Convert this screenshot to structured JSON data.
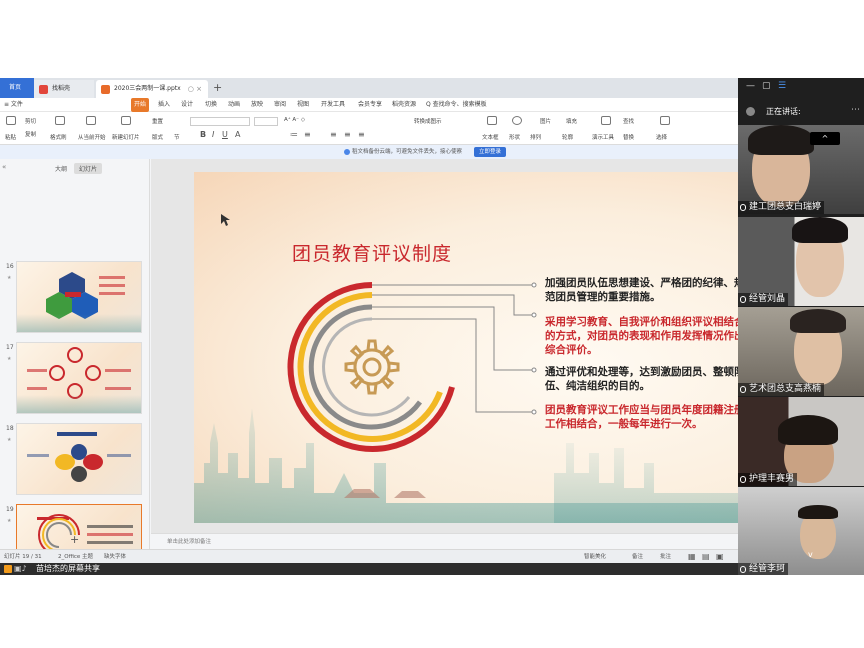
{
  "wps": {
    "tabs": {
      "home": "首页",
      "template": "找稻壳",
      "document": "2020三会两制一课.pptx",
      "close": "○ ×",
      "add": "+"
    },
    "menu": [
      "≡ 文件",
      "开始",
      "插入",
      "设计",
      "切换",
      "动画",
      "放映",
      "审阅",
      "视图",
      "开发工具",
      "会员专享",
      "稻壳资源",
      "Q 查找命令、搜索模板"
    ],
    "menu_active_index": 1,
    "toolbar": {
      "paste": "粘贴",
      "cut": "剪切",
      "copy": "复制",
      "format_painter": "格式刷",
      "from_start": "从当前开始",
      "new_slide": "新建幻灯片",
      "layout": "版式",
      "section": "节",
      "reset": "重置",
      "text_box": "文本框",
      "shape": "形状",
      "arrange": "排列",
      "outline": "轮廓",
      "image": "图片",
      "fill": "填充",
      "present_tools": "演示工具",
      "find": "查找",
      "replace": "替换",
      "select": "选择",
      "convert_smartart": "转换成图示",
      "font_sizes": "A⁺ A⁻ ◇"
    },
    "notice": {
      "text": "稻文档备份云端，可避免文件丢失，接心使察",
      "button": "立即登录"
    },
    "thumbnail_panel": {
      "tab_outline": "大纲",
      "tab_slides": "幻灯片",
      "slide_numbers": [
        "16",
        "17",
        "18",
        "19",
        "20"
      ],
      "add": "+"
    },
    "slide": {
      "title": "团员教育评议制度",
      "bullets": [
        {
          "text": "加强团员队伍思想建设、严格团的纪律、规范团员管理的重要措施。",
          "style": "dark"
        },
        {
          "text": "采用学习教育、自我评价和组织评议相结合的方式，对团员的表现和作用发挥情况作出综合评价。",
          "style": "red"
        },
        {
          "text": "通过评优和处理等，达到激励团员、整顿队伍、纯洁组织的目的。",
          "style": "dark"
        },
        {
          "text": "团员教育评议工作应当与团员年度团籍注册工作相结合，一般每年进行一次。",
          "style": "red"
        }
      ]
    },
    "notes_placeholder": "单击此处添加备注",
    "status": {
      "slide_count": "幻灯片 19 / 31",
      "theme": "2_Office 主题",
      "missing_font": "缺失字体",
      "smart_beautify": "智能美化",
      "notes": "备注",
      "comments": "批注"
    },
    "share_label": "苗培杰的屏幕共享"
  },
  "meeting": {
    "speaking_label": "正在讲话:",
    "scroll_up": "^",
    "scroll_down": "v",
    "participants": [
      {
        "name": "建工团总支白瑞婷"
      },
      {
        "name": "经管刘晶"
      },
      {
        "name": "艺术团总支高燕楠"
      },
      {
        "name": "护理丰赛男"
      },
      {
        "name": "经管李珂"
      }
    ]
  },
  "colors": {
    "accent_orange": "#e8792a",
    "wps_blue": "#3470d6",
    "slide_red": "#c9282d",
    "ring_yellow": "#f2b824",
    "ring_gray": "#8a8a8a"
  }
}
